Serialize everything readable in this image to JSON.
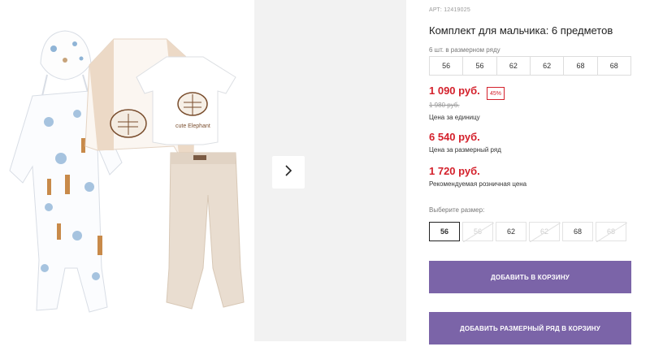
{
  "product": {
    "article": "АРТ: 12419025",
    "title": "Комплект для мальчика: 6 предметов",
    "quantity_text": "6 шт. в размерном ряду",
    "size_row": [
      "56",
      "56",
      "62",
      "62",
      "68",
      "68"
    ],
    "image_print_text": "cute Elephant"
  },
  "prices": {
    "unit_price": "1 090 руб.",
    "discount": "45%",
    "old_price": "1 980 руб.",
    "unit_caption": "Цена за единицу",
    "row_price": "6 540 руб.",
    "row_caption": "Цена за размерный ряд",
    "retail_price": "1 720 руб.",
    "retail_caption": "Рекомендуемая розничная цена"
  },
  "size_select": {
    "label": "Выберите размер:",
    "options": [
      {
        "label": "56",
        "state": "selected"
      },
      {
        "label": "56",
        "state": "disabled"
      },
      {
        "label": "62",
        "state": "available"
      },
      {
        "label": "62",
        "state": "disabled"
      },
      {
        "label": "68",
        "state": "available"
      },
      {
        "label": "68",
        "state": "disabled"
      }
    ]
  },
  "actions": {
    "add_to_cart": "ДОБАВИТЬ В КОРЗИНУ",
    "add_row_to_cart": "ДОБАВИТЬ РАЗМЕРНЫЙ РЯД В КОРЗИНУ"
  },
  "colors": {
    "price_red": "#d4212c",
    "button_purple": "#7b64a8",
    "panel_gray": "#f2f2f2"
  },
  "icons": {
    "next": "chevron-right-icon"
  }
}
